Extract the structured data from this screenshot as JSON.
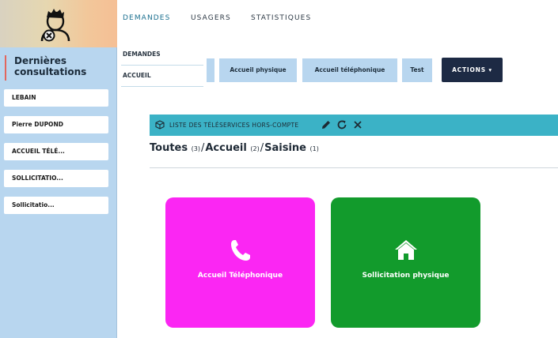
{
  "sidebar": {
    "title": "Dernières consultations",
    "items": [
      {
        "label": "LEBAIN"
      },
      {
        "label": "Pierre DUPOND"
      },
      {
        "label": "ACCUEIL TÉLÉ..."
      },
      {
        "label": "SOLLICITATIO..."
      },
      {
        "label": "Sollicitatio..."
      }
    ]
  },
  "nav": {
    "tabs": [
      {
        "label": "DEMANDES",
        "active": true
      },
      {
        "label": "USAGERS"
      },
      {
        "label": "STATISTIQUES"
      }
    ]
  },
  "dropdown": {
    "items": [
      {
        "label": "DEMANDES"
      },
      {
        "label": "ACCUEIL"
      }
    ]
  },
  "subtabs": [
    {
      "label": "Accueil physique"
    },
    {
      "label": "Accueil téléphonique"
    },
    {
      "label": "Test"
    }
  ],
  "actions": {
    "label": "ACTIONS ▾"
  },
  "panel": {
    "title": "LISTE DES TÉLÉSERVICES HORS-COMPTE"
  },
  "breadcrumb": {
    "items": [
      {
        "label": "Toutes",
        "count": "(3)"
      },
      {
        "label": "Accueil",
        "count": "(2)"
      },
      {
        "label": "Saisine",
        "count": "(1)"
      }
    ],
    "separator": "/"
  },
  "cards": [
    {
      "label": "Accueil Téléphonique",
      "icon": "phone-icon",
      "color": "#fb26f3"
    },
    {
      "label": "Sollicitation physique",
      "icon": "home-icon",
      "color": "#129b2c"
    }
  ],
  "colors": {
    "sidebar": "#b8d6ef",
    "teal": "#3bb2c6",
    "actions": "#1d2a44",
    "accent_border": "#e2665e"
  }
}
